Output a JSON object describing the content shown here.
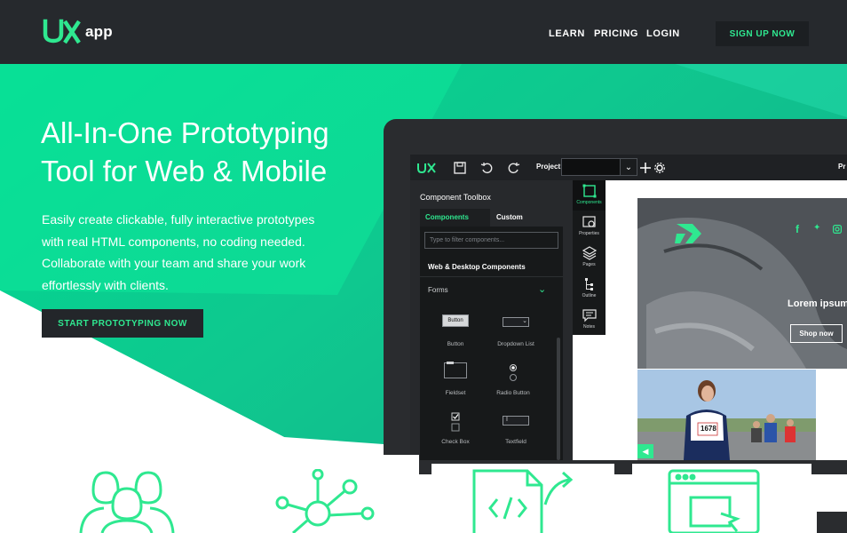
{
  "brand": {
    "logo_mark": "UX",
    "logo_word": "app"
  },
  "nav": {
    "learn": "LEARN",
    "pricing": "PRICING",
    "login": "LOGIN",
    "signup": "SIGN UP NOW"
  },
  "hero": {
    "title_line1": "All-In-One Prototyping",
    "title_line2": "Tool for Web & Mobile",
    "desc_line1": "Easily create clickable, fully interactive prototypes",
    "desc_line2": "with real HTML components, no coding needed.",
    "desc_line3": "Collaborate with your team and share your work",
    "desc_line4": "effortlessly with clients.",
    "cta": "START PROTOTYPING NOW"
  },
  "app": {
    "logo": "UX",
    "project_label": "Project:",
    "project_value": "",
    "header_clip": "Pr",
    "toolbox": {
      "title": "Component Toolbox",
      "tab_components": "Components",
      "tab_custom": "Custom",
      "filter_placeholder": "Type to filter components...",
      "section": "Web & Desktop Components",
      "group": "Forms",
      "items": {
        "button_preview": "Button",
        "button": "Button",
        "dropdown": "Dropdown List",
        "fieldset": "Fieldset",
        "radio": "Radio Button",
        "checkbox": "Check Box",
        "textfield": "Textfield"
      }
    },
    "sidebar": {
      "components": "Components",
      "properties": "Properties",
      "pages": "Pages",
      "outline": "Outline",
      "notes": "Notes"
    },
    "canvas": {
      "headline": "Lorem ipsum dolor",
      "shop_button": "Shop now",
      "bib_number": "1678"
    }
  },
  "colors": {
    "accent": "#2fe890",
    "topbar": "#26292d",
    "dark": "#1f2124"
  }
}
